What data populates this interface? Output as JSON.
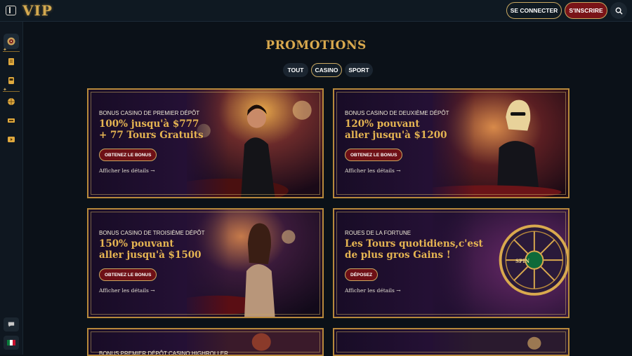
{
  "header": {
    "logo": "VIP",
    "login_label": "SE CONNECTER",
    "signup_label": "S'INSCRIRE"
  },
  "sidebar": {
    "items": [
      {
        "icon": "roulette-icon"
      },
      {
        "icon": "notes-icon"
      },
      {
        "icon": "slot-machine-icon"
      },
      {
        "icon": "basketball-icon"
      },
      {
        "icon": "live-icon"
      },
      {
        "icon": "video-icon"
      }
    ],
    "bottom": [
      {
        "icon": "chat-icon"
      },
      {
        "icon": "mexico-flag-icon"
      }
    ]
  },
  "page": {
    "title": "PROMOTIONS",
    "tabs": [
      {
        "label": "TOUT",
        "active": false
      },
      {
        "label": "CASINO",
        "active": true
      },
      {
        "label": "SPORT",
        "active": false
      }
    ]
  },
  "promos": [
    {
      "kicker": "BONUS CASINO DE PREMIER DÉPÔT",
      "headline_1": "100% jusqu'à $777",
      "headline_2": "+ 77 Tours Gratuits",
      "cta": "OBTENEZ LE BONUS",
      "details": "Afficher les détails →"
    },
    {
      "kicker": "BONUS CASINO DE DEUXIÈME DÉPÔT",
      "headline_1": "120% pouvant",
      "headline_2": "aller jusqu'à $1200",
      "cta": "OBTENEZ LE BONUS",
      "details": "Afficher les détails →"
    },
    {
      "kicker": "BONUS CASINO DE TROISIÈME DÉPÔT",
      "headline_1": "150% pouvant",
      "headline_2": "aller jusqu'à $1500",
      "cta": "OBTENEZ LE BONUS",
      "details": "Afficher les détails →"
    },
    {
      "kicker": "ROUES DE LA FORTUNE",
      "headline_1": "Les Tours quotidiens,c'est",
      "headline_2": "de plus gros Gains !",
      "cta": "DÉPOSEZ",
      "details": "Afficher les détails →",
      "wheel_label": "SPIN"
    },
    {
      "kicker": "BONUS PREMIER DÉPÔT CASINO HIGHROLLER"
    },
    {
      "kicker": ""
    }
  ],
  "colors": {
    "gold": "#d9a94e",
    "cta_red": "#6e1016",
    "background": "#0b1118"
  }
}
